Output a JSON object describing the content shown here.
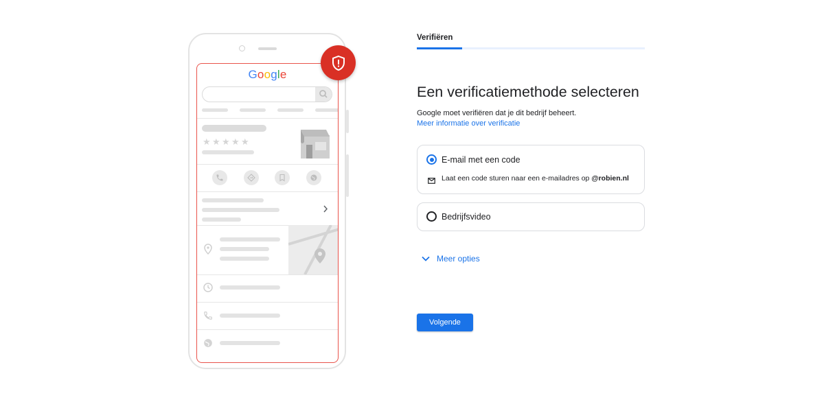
{
  "illustration": {
    "logo_text": "Google",
    "colors": {
      "frame_outline": "#e9524a",
      "badge": "#d93025"
    },
    "icons": [
      "shield-alert-icon",
      "search-icon",
      "phone-icon",
      "directions-icon",
      "bookmark-icon",
      "globe-icon",
      "chevron-right-icon",
      "location-pin-icon",
      "clock-icon",
      "storefront-icon",
      "map-icon"
    ],
    "rating_stars": 5
  },
  "stepper": {
    "tab_label": "Verifiëren",
    "progress": 0.2
  },
  "main": {
    "title": "Een verificatiemethode selecteren",
    "description": "Google moet verifiëren dat je dit bedrijf beheert.",
    "info_link": "Meer informatie over verificatie",
    "options": [
      {
        "label": "E-mail met een code",
        "selected": true,
        "detail_prefix": "Laat een code sturen naar een e-mailadres op",
        "detail_domain": "@robien.nl",
        "icon": "mail-icon"
      },
      {
        "label": "Bedrijfsvideo",
        "selected": false
      }
    ],
    "more_options": "Meer opties",
    "next_button": "Volgende"
  },
  "colors": {
    "accent": "#1a73e8",
    "text": "#202124",
    "border": "#dadce0"
  }
}
